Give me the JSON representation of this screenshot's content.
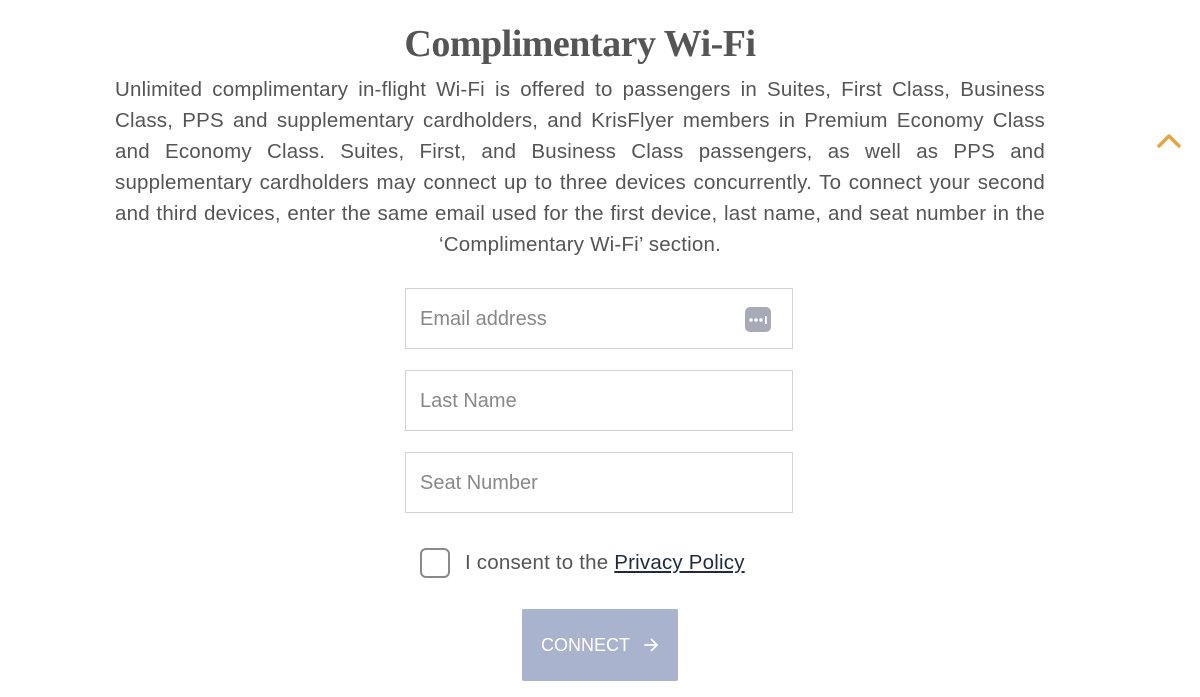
{
  "header": {
    "title": "Complimentary Wi-Fi"
  },
  "intro": {
    "text": "Unlimited complimentary in-flight Wi-Fi is offered to passengers in Suites, First Class, Business Class, PPS and supplementary cardholders, and KrisFlyer members in Premium Economy Class and Economy Class. Suites, First, and Business Class passengers, as well as PPS and supplementary cardholders may connect up to three devices concurrently. To connect your second and third devices, enter the same email used for the first device, last name, and seat number in the ‘Complimentary Wi-Fi’ section."
  },
  "form": {
    "email": {
      "placeholder": "Email address",
      "value": "",
      "autofill_icon": "password-autofill-icon"
    },
    "last_name": {
      "placeholder": "Last Name",
      "value": ""
    },
    "seat_number": {
      "placeholder": "Seat Number",
      "value": ""
    },
    "consent": {
      "checked": false,
      "text": "I consent to the ",
      "link_text": "Privacy Policy"
    },
    "connect_button": {
      "label": "CONNECT",
      "icon": "arrow-right-icon"
    }
  },
  "scroll_top": {
    "icon": "chevron-up-icon"
  },
  "colors": {
    "text": "#555555",
    "border": "#d3d3d3",
    "button_bg": "#aab3cd",
    "button_text": "#ffffff",
    "link": "#1f2a44",
    "accent": "#e8a33d",
    "autofill_icon_bg": "#a7abb8"
  }
}
